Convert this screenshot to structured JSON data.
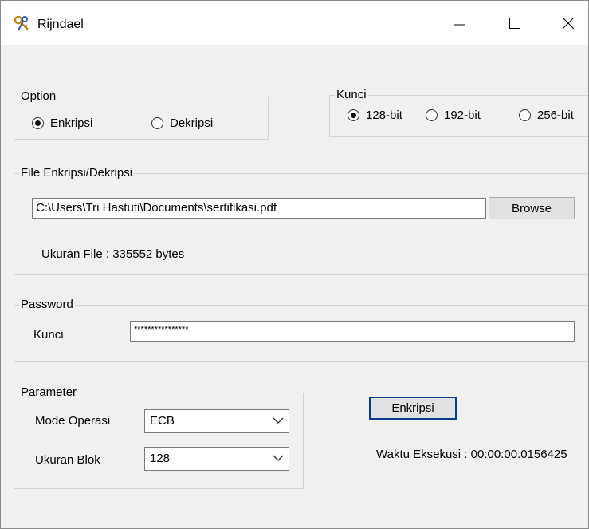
{
  "window": {
    "title": "Rijndael"
  },
  "option": {
    "legend": "Option",
    "items": [
      {
        "label": "Enkripsi",
        "selected": true
      },
      {
        "label": "Dekripsi",
        "selected": false
      }
    ]
  },
  "kunci": {
    "legend": "Kunci",
    "items": [
      {
        "label": "128-bit",
        "selected": true
      },
      {
        "label": "192-bit",
        "selected": false
      },
      {
        "label": "256-bit",
        "selected": false
      }
    ]
  },
  "file": {
    "legend": "File Enkripsi/Dekripsi",
    "path": "C:\\Users\\Tri Hastuti\\Documents\\sertifikasi.pdf",
    "browse_label": "Browse",
    "size_text": "Ukuran File : 335552 bytes"
  },
  "password": {
    "legend": "Password",
    "label": "Kunci",
    "value": "****************"
  },
  "parameter": {
    "legend": "Parameter",
    "mode_label": "Mode Operasi",
    "mode_value": "ECB",
    "block_label": "Ukuran Blok",
    "block_value": "128"
  },
  "action": {
    "button_label": "Enkripsi",
    "time_text": "Waktu Eksekusi : 00:00:00.0156425"
  }
}
